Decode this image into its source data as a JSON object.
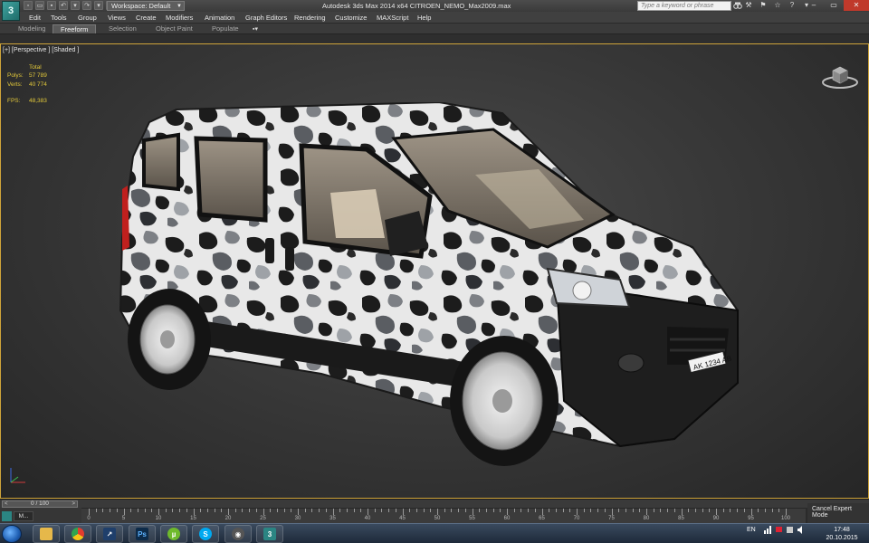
{
  "titlebar": {
    "workspace": "Workspace: Default",
    "window_title": "Autodesk 3ds Max  2014 x64      CITROEN_NEMO_Max2009.max",
    "search_placeholder": "Type a keyword or phrase"
  },
  "menu": [
    "Edit",
    "Tools",
    "Group",
    "Views",
    "Create",
    "Modifiers",
    "Animation",
    "Graph Editors",
    "Rendering",
    "Customize",
    "MAXScript",
    "Help"
  ],
  "ribbon": {
    "tabs": [
      "Modeling",
      "Freeform",
      "Selection",
      "Object Paint",
      "Populate"
    ],
    "active_tab": "Freeform"
  },
  "viewport": {
    "label": "[+] [Perspective ] [Shaded ]",
    "stats": {
      "header": "Total",
      "polys_label": "Polys:",
      "polys": "57 789",
      "verts_label": "Verts:",
      "verts": "40 774",
      "fps_label": "FPS:",
      "fps": "48,383"
    },
    "license_plate": "AK 1234 AB"
  },
  "timeslider": {
    "position": "0 / 100",
    "prev": "<",
    "next": ">"
  },
  "trackbar": {
    "labels": [
      "0",
      "5",
      "10",
      "15",
      "20",
      "25",
      "30",
      "35",
      "40",
      "45",
      "50",
      "55",
      "60",
      "65",
      "70",
      "75",
      "80",
      "85",
      "90",
      "95",
      "100"
    ]
  },
  "status": {
    "cancel_expert": "Cancel Expert Mode",
    "mini_label": "M..."
  },
  "taskbar": {
    "language": "EN",
    "time": "17:48",
    "date": "20.10.2015"
  },
  "colors": {
    "viewport_border": "#cfa43a",
    "stats_text": "#e3c93a",
    "app_accent": "#2b8583"
  }
}
